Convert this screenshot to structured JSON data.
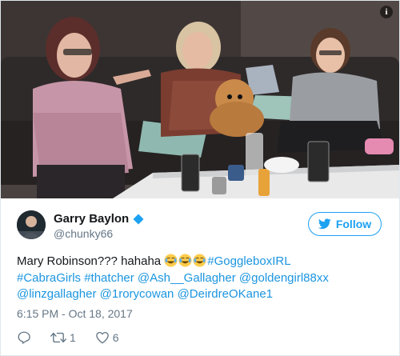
{
  "media": {
    "info_icon": "info-icon",
    "info_text": "i"
  },
  "author": {
    "name": "Garry Baylon",
    "handle": "@chunky66",
    "verified_icon": "verified-badge-icon",
    "follow_label": "Follow",
    "follow_icon": "twitter-bird-icon",
    "accent": "#1da1f2"
  },
  "tweet": {
    "text_prefix": "Mary Robinson??? hahaha ",
    "emoji": [
      "face-with-tears-of-joy-icon",
      "face-with-tears-of-joy-icon",
      "face-with-tears-of-joy-icon"
    ],
    "links": [
      "#GoggleboxIRL",
      "#CabraGirls",
      "#thatcher",
      "@Ash__Gallagher",
      "@goldengirl88xx",
      "@linzgallagher",
      "@1rorycowan",
      "@DeirdreOKane1"
    ],
    "timestamp": "6:15 PM - Oct 18, 2017",
    "link_color": "#1b95e0"
  },
  "actions": {
    "reply_icon": "reply-icon",
    "retweet_icon": "retweet-icon",
    "retweet_count": "1",
    "like_icon": "heart-icon",
    "like_count": "6"
  }
}
